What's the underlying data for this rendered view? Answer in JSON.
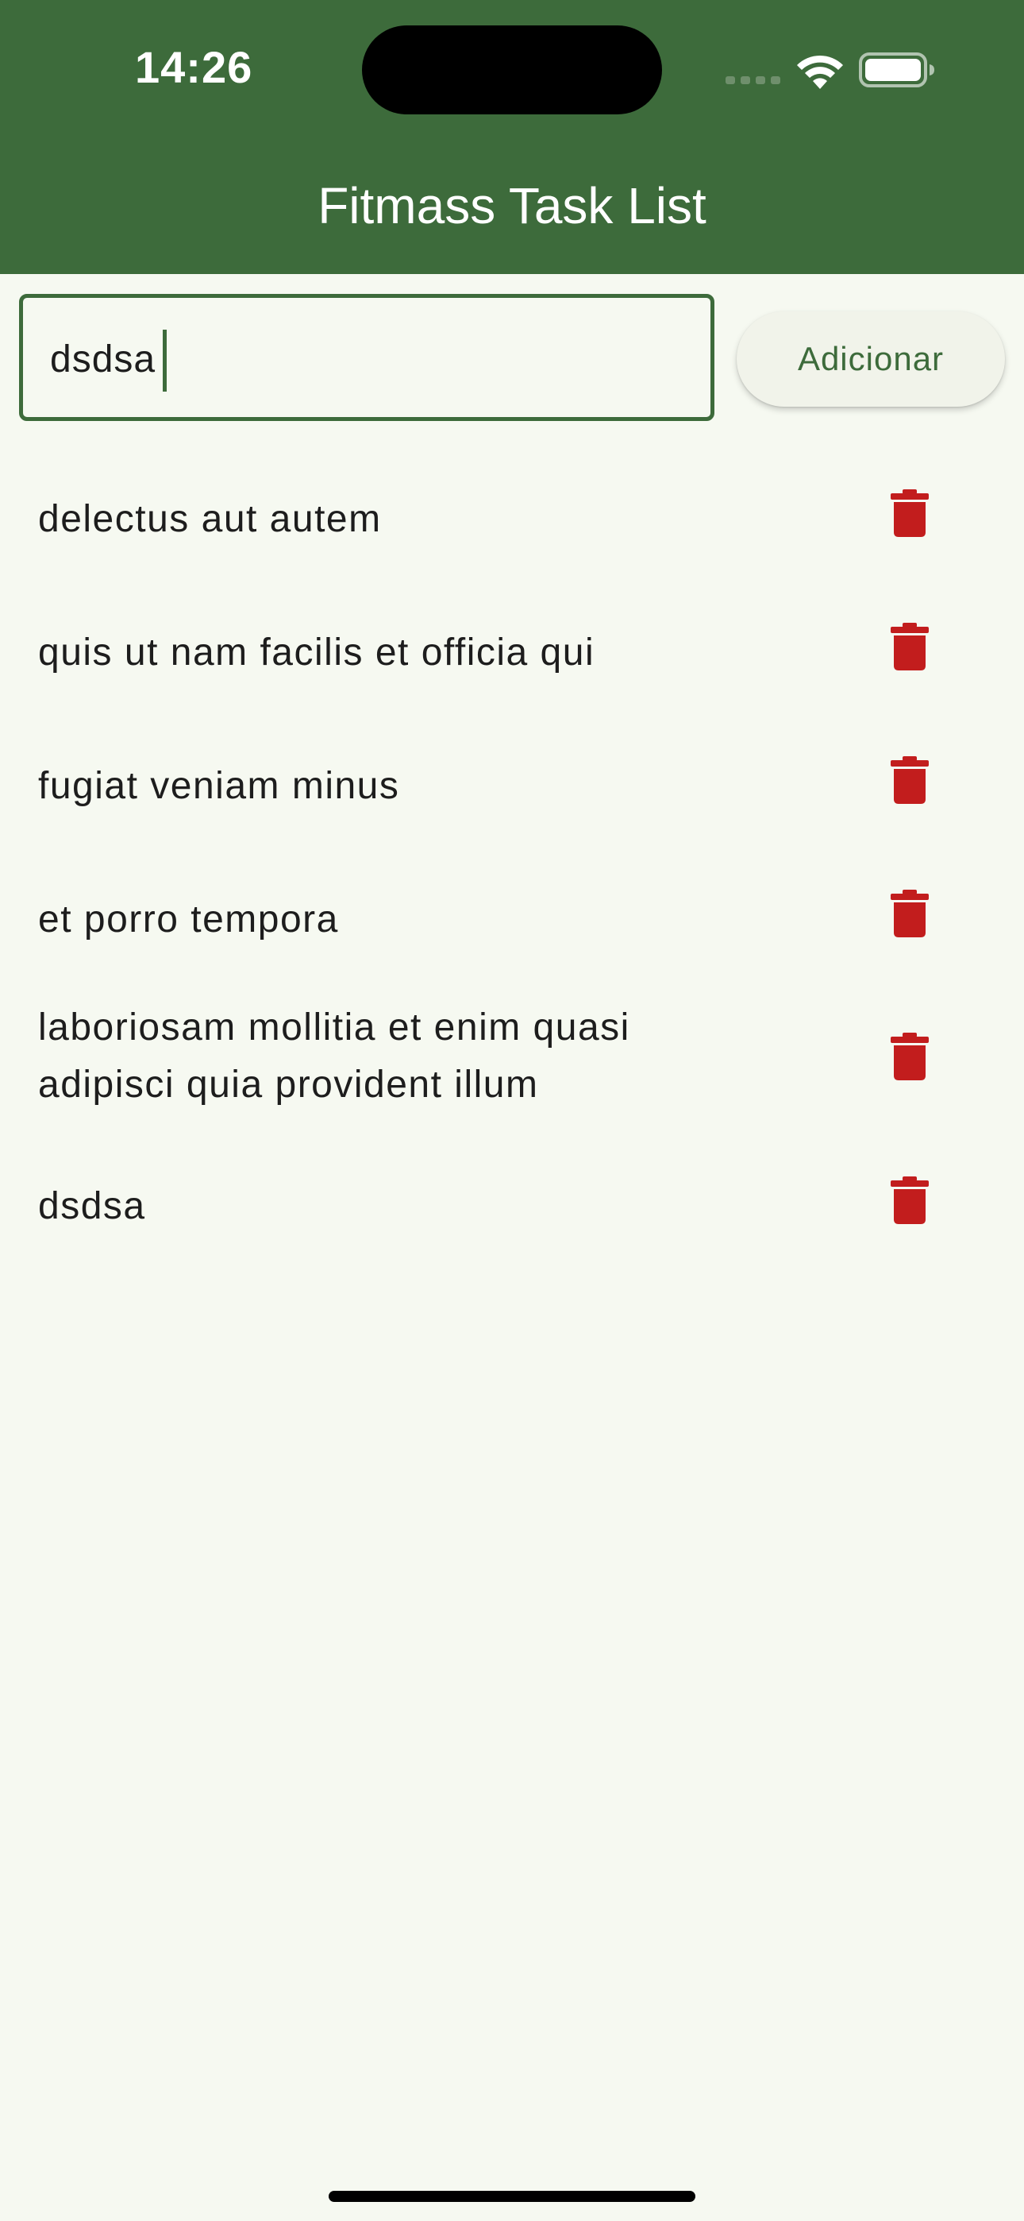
{
  "status_bar": {
    "time": "14:26"
  },
  "app_bar": {
    "title": "Fitmass Task List"
  },
  "new_task": {
    "value": "dsdsa",
    "add_label": "Adicionar"
  },
  "tasks": [
    {
      "text": "delectus aut autem"
    },
    {
      "text": "quis ut nam facilis et officia qui"
    },
    {
      "text": "fugiat veniam minus"
    },
    {
      "text": "et porro tempora"
    },
    {
      "text": "laboriosam mollitia et enim quasi adipisci quia provident illum"
    },
    {
      "text": "dsdsa"
    }
  ],
  "icons": {
    "delete": "trash-icon",
    "wifi": "wifi-icon",
    "battery": "battery-icon",
    "signal": "signal-icon"
  },
  "colors": {
    "primary": "#3d6b3b",
    "background": "#f6f9f1",
    "delete": "#c21d1d"
  }
}
